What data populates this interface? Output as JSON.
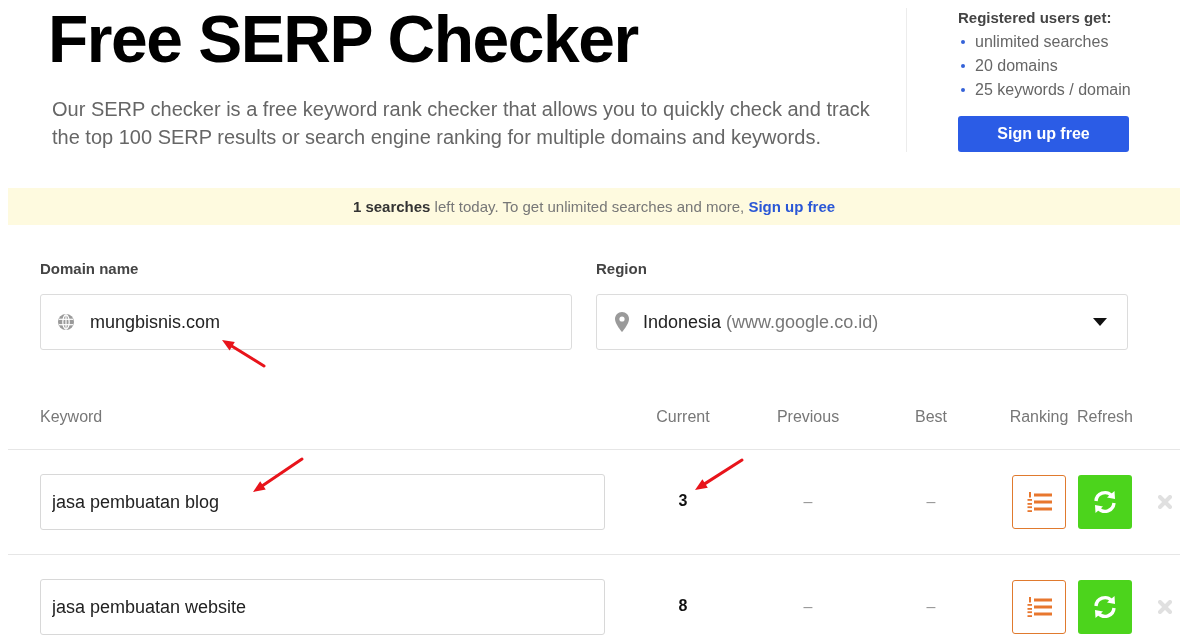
{
  "header": {
    "title": "Free SERP Checker",
    "description": "Our SERP checker is a free keyword rank checker that allows you to quickly check and track the top 100 SERP results or search engine ranking for multiple domains and keywords."
  },
  "promo": {
    "heading": "Registered users get:",
    "benefits": [
      "unlimited searches",
      "20 domains",
      "25 keywords / domain"
    ],
    "button": "Sign up free"
  },
  "notice": {
    "text": "**1 searches** left today. To get unlimited searches and more,",
    "link": "Sign up free"
  },
  "form": {
    "domain": {
      "label": "Domain name",
      "value": "mungbisnis.com",
      "marked": true
    },
    "region": {
      "label": "Region",
      "value": "Indonesia",
      "hint": "(www.google.co.id)"
    }
  },
  "table": {
    "columns": [
      "Keyword",
      "Current",
      "Previous",
      "Best",
      "Ranking",
      "Refresh"
    ],
    "rows": [
      {
        "keyword": "jasa pembuatan blog",
        "keyword_marked": true,
        "current": "3",
        "current_marked": true,
        "previous": "–",
        "best": "–"
      },
      {
        "keyword": "jasa pembuatan website",
        "keyword_marked": false,
        "current": "8",
        "current_marked": false,
        "previous": "–",
        "best": "–"
      }
    ]
  }
}
